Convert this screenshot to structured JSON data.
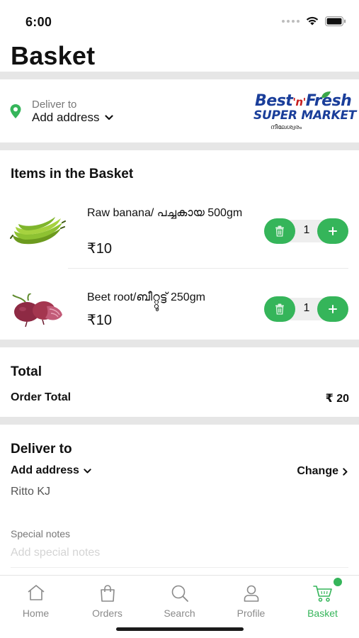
{
  "status_bar": {
    "time": "6:00"
  },
  "page": {
    "title": "Basket"
  },
  "delivery_header": {
    "label": "Deliver to",
    "address": "Add address"
  },
  "store_logo": {
    "line1": "Best",
    "line1_mid": "'n'",
    "line1_end": "Fresh",
    "line2": "SUPER MARKET",
    "line3": "നീലേശ്വരം"
  },
  "items_section": {
    "title": "Items in the Basket"
  },
  "items": [
    {
      "name": "Raw banana/ പച്ചകായ 500gm",
      "price": "₹10",
      "quantity": "1",
      "image_icon": "banana-icon"
    },
    {
      "name": "Beet root/ബീറ്റ്റൂട്ട് 250gm",
      "price": "₹10",
      "quantity": "1",
      "image_icon": "beetroot-icon"
    }
  ],
  "total_section": {
    "title": "Total",
    "label": "Order Total",
    "value": "₹ 20"
  },
  "deliver_section": {
    "title": "Deliver to",
    "address_select": "Add address",
    "change_label": "Change",
    "customer_name": "Ritto KJ",
    "notes_label": "Special notes",
    "notes_placeholder": "Add special notes"
  },
  "tabs": [
    {
      "label": "Home",
      "icon": "home-icon"
    },
    {
      "label": "Orders",
      "icon": "shopping-bag-icon"
    },
    {
      "label": "Search",
      "icon": "search-icon"
    },
    {
      "label": "Profile",
      "icon": "user-icon"
    },
    {
      "label": "Basket",
      "icon": "cart-icon",
      "active": true,
      "has_badge": true
    }
  ],
  "colors": {
    "accent": "#35b55a",
    "divider": "#e6e6e6",
    "brand_blue": "#1a3e9a"
  }
}
